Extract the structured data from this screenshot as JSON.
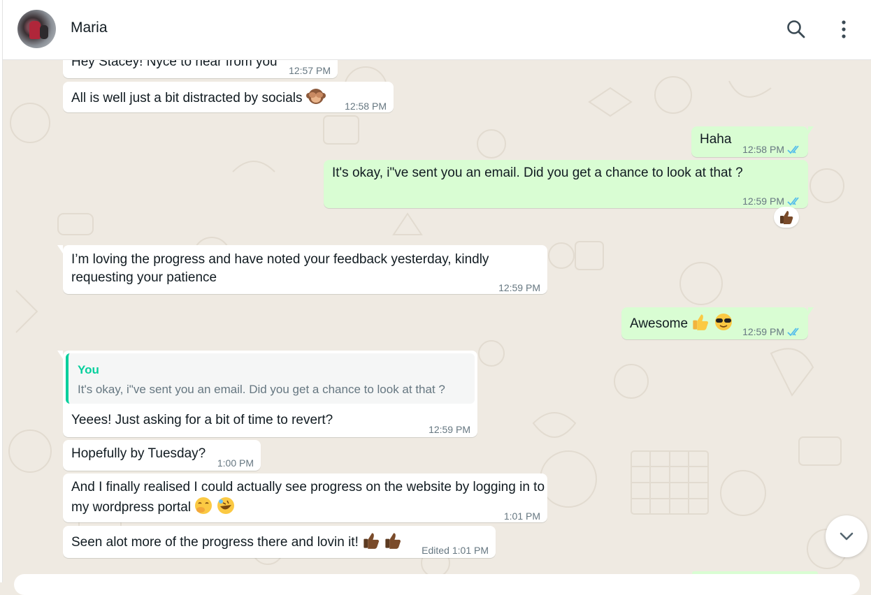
{
  "header": {
    "contact_name": "Maria",
    "icons": [
      "avatar",
      "search-icon",
      "menu-icon"
    ]
  },
  "messages": [
    {
      "dir": "in",
      "text": "Hey Stacey! Nyce to hear from you",
      "time": "12:57 PM"
    },
    {
      "dir": "in",
      "text": "All is well just a bit distracted by socials",
      "emoji": "see-no-evil-monkey",
      "time": "12:58 PM"
    },
    {
      "dir": "out",
      "text": "Haha",
      "time": "12:58 PM",
      "read": true
    },
    {
      "dir": "out",
      "text": "It's okay, i\"ve sent you an email. Did you get a chance to look at that ?",
      "time": "12:59 PM",
      "read": true,
      "reaction": "thumbs-up"
    },
    {
      "dir": "in",
      "text": "I’m loving the progress and have noted your feedback yesterday, kindly requesting your patience",
      "time": "12:59 PM"
    },
    {
      "dir": "out",
      "text": "Awesome",
      "emoji": "thumbs-up, sunglasses-face",
      "time": "12:59 PM",
      "read": true
    },
    {
      "dir": "in",
      "quote_author": "You",
      "quote_text": "It's okay, i\"ve sent you an email. Did you get a chance to look at that ?",
      "text": "Yeees! Just asking for a bit of time to revert?",
      "time": "12:59 PM"
    },
    {
      "dir": "in",
      "text": "Hopefully by Tuesday?",
      "time": "1:00 PM"
    },
    {
      "dir": "in",
      "text": "And I finally realised I could actually see progress on the website by logging in to my wordpress portal",
      "emoji": "hand-over-mouth, rolling-laughing",
      "time": "1:01 PM"
    },
    {
      "dir": "in",
      "text": "Seen alot more of the progress there and lovin it!",
      "emoji": "thumbs-up, thumbs-up",
      "edited": "Edited",
      "time": "1:01 PM"
    }
  ],
  "scroll_button": {
    "icon": "chevron-down-icon"
  },
  "colors": {
    "incoming": "#ffffff",
    "outgoing": "#d9fdd3",
    "wallpaper": "#efeae2",
    "tick": "#53bdeb",
    "quote_accent": "#06cf9c"
  }
}
